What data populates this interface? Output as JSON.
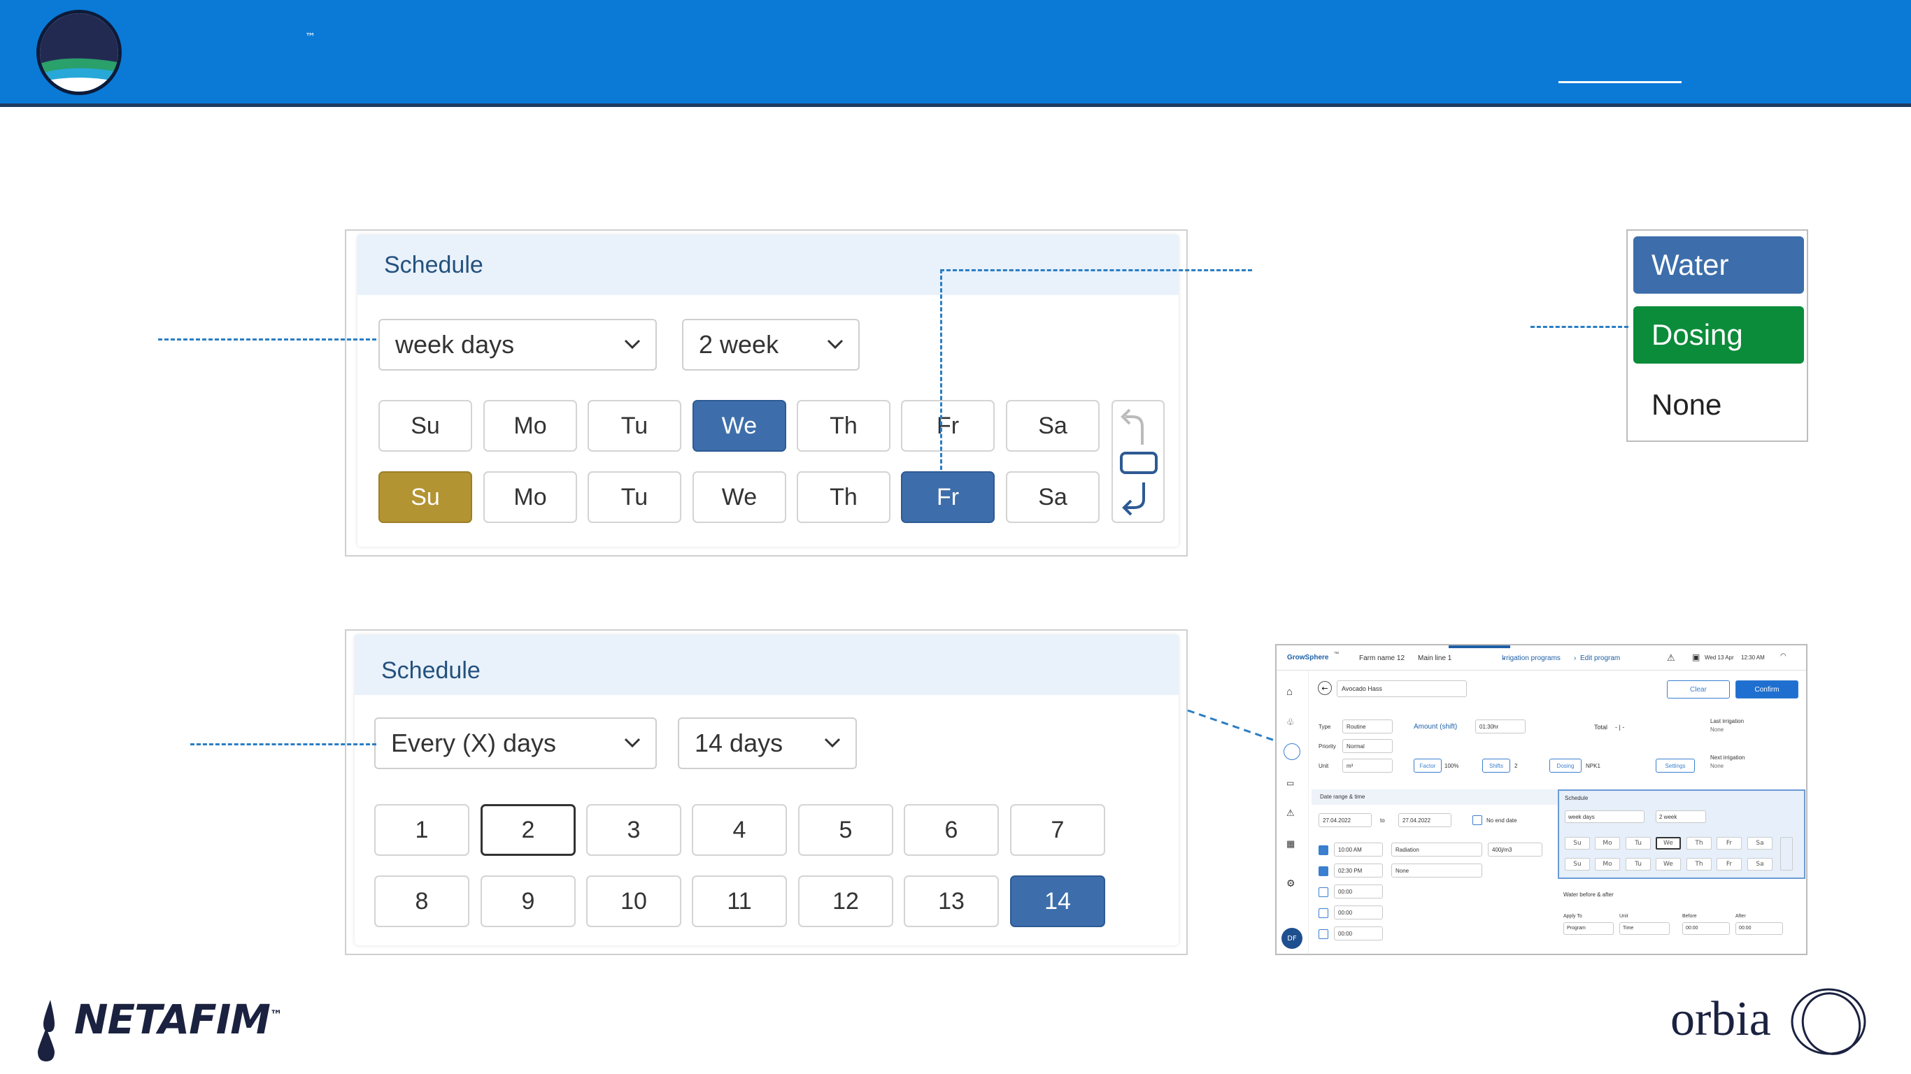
{
  "header": {
    "trademark": "™"
  },
  "top_panel": {
    "title": "Schedule",
    "repeat_type": "week days",
    "period": "2 week",
    "week1": [
      "Su",
      "Mo",
      "Tu",
      "We",
      "Th",
      "Fr",
      "Sa"
    ],
    "week2": [
      "Su",
      "Mo",
      "Tu",
      "We",
      "Th",
      "Fr",
      "Sa"
    ],
    "week1_selected": "We",
    "week2_selected": "Fr",
    "week2_highlight": "Su"
  },
  "bottom_panel": {
    "title": "Schedule",
    "repeat_type": "Every (X) days",
    "period": "14 days",
    "days": [
      "1",
      "2",
      "3",
      "4",
      "5",
      "6",
      "7",
      "8",
      "9",
      "10",
      "11",
      "12",
      "13",
      "14"
    ],
    "outlined": "2",
    "selected": "14"
  },
  "legend": {
    "items": [
      {
        "label": "Water",
        "color": "#3d6eab"
      },
      {
        "label": "Dosing",
        "color": "#0b8c3a"
      },
      {
        "label": "None",
        "color": "#ffffff"
      }
    ]
  },
  "mini": {
    "brand": "GrowSphere",
    "brand_tm": "™",
    "farm": "Farm name 12",
    "main_line": "Main line 1",
    "crumb1": "Irrigation programs",
    "crumb2": "Edit program",
    "date": "Wed 13 Apr",
    "time": "12:30 AM",
    "program_name": "Avocado Hass",
    "clear": "Clear",
    "confirm": "Confirm",
    "type_label": "Type",
    "type_val": "Routine",
    "priority_label": "Priority",
    "priority_val": "Normal",
    "unit_label": "Unit",
    "unit_val": "m³",
    "amount_label": "Amount (shift)",
    "amount_val": "01:30hr",
    "total_label": "Total",
    "total_val": "- | -",
    "last_irrig_label": "Last irrigation",
    "last_irrig_val": "None",
    "next_irrig_label": "Next irrigation",
    "next_irrig_val": "None",
    "factor": "Factor",
    "factor_val": "100%",
    "shifts": "Shifts",
    "shifts_val": "2",
    "dosing": "Dosing",
    "dosing_val": "NPK1",
    "settings": "Settings",
    "date_range_label": "Date range & time",
    "date_from": "27.04.2022",
    "to": "to",
    "date_to": "27.04.2022",
    "no_end": "No end date",
    "time_rows": [
      {
        "time": "10:00 AM",
        "cond": "Radiation",
        "val": "400j/m3",
        "on": true
      },
      {
        "time": "02:30 PM",
        "cond": "None",
        "val": "",
        "on": true
      },
      {
        "time": "00:00",
        "cond": "",
        "val": "",
        "on": false
      },
      {
        "time": "00:00",
        "cond": "",
        "val": "",
        "on": false
      },
      {
        "time": "00:00",
        "cond": "",
        "val": "",
        "on": false
      }
    ],
    "sched_label": "Schedule",
    "sched_type": "week days",
    "sched_period": "2 week",
    "days": [
      "Su",
      "Mo",
      "Tu",
      "We",
      "Th",
      "Fr",
      "Sa"
    ],
    "water_label": "Water before & after",
    "apply_label": "Apply To",
    "apply_val": "Program",
    "unit2_label": "Unit",
    "unit2_val": "Time",
    "before_label": "Before",
    "before_val": "00:00",
    "after_label": "After",
    "after_val": "00:00",
    "avatar": "DF"
  },
  "footer": {
    "left_logo": "NETAFIM",
    "left_tm": "™",
    "right_logo": "orbia"
  }
}
